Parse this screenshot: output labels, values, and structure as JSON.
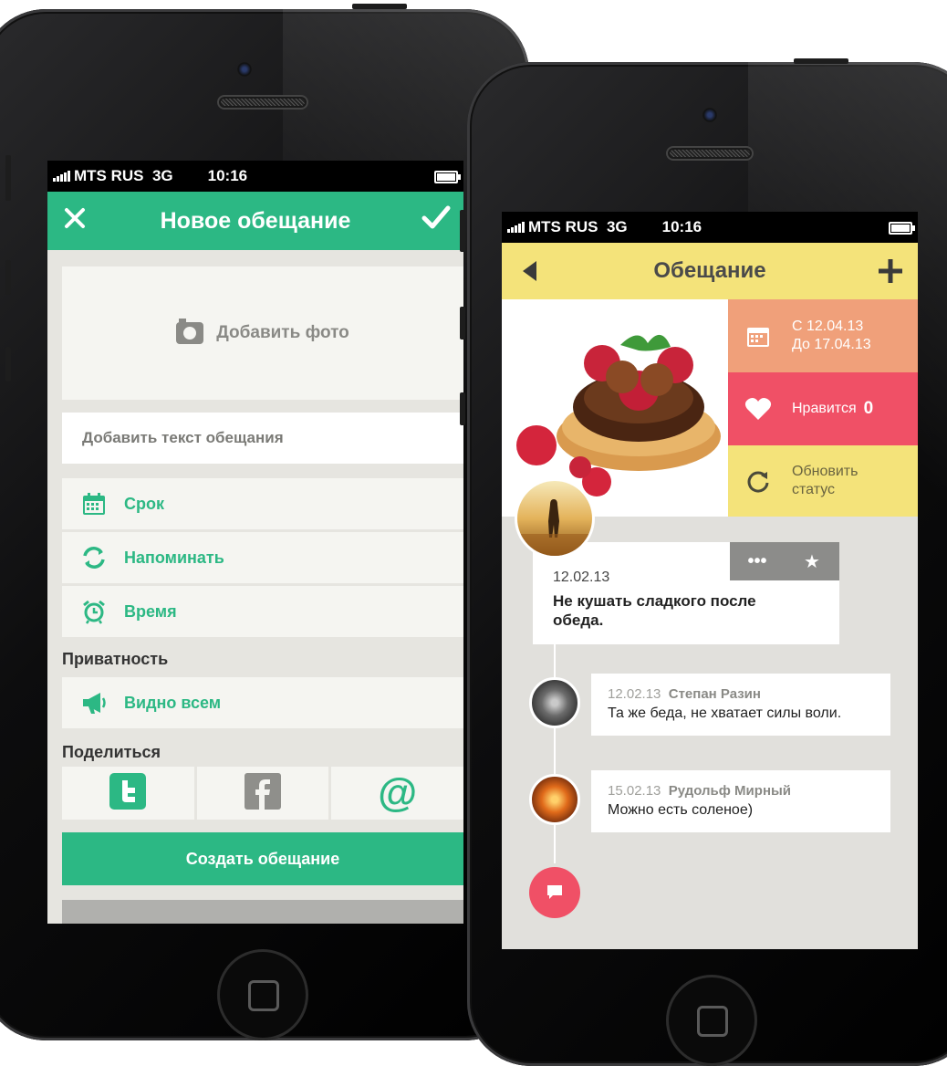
{
  "colors": {
    "green_accent": "#2cb884",
    "yellow_header": "#f4e37a",
    "salmon_tile": "#f0a07a",
    "red_tile": "#f05066",
    "yellow_tile": "#f4e37a"
  },
  "left_phone": {
    "status": {
      "carrier": "MTS RUS",
      "network": "3G",
      "time": "10:16"
    },
    "header": {
      "title": "Новое обещание",
      "close_icon": "close-icon",
      "confirm_icon": "checkmark-icon"
    },
    "photo": {
      "label": "Добавить фото",
      "icon": "camera-icon"
    },
    "text_field": {
      "placeholder": "Добавить текст обещания"
    },
    "options": [
      {
        "label": "Срок",
        "icon": "calendar-icon"
      },
      {
        "label": "Напоминать",
        "icon": "repeat-icon"
      },
      {
        "label": "Время",
        "icon": "alarm-clock-icon"
      }
    ],
    "privacy": {
      "section_title": "Приватность",
      "label": "Видно всем",
      "icon": "megaphone-icon"
    },
    "share": {
      "section_title": "Поделиться",
      "targets": [
        {
          "name": "twitter",
          "icon": "twitter-icon"
        },
        {
          "name": "facebook",
          "icon": "facebook-icon"
        },
        {
          "name": "email",
          "icon": "at-sign-icon"
        }
      ]
    },
    "create_button": "Создать обещание"
  },
  "right_phone": {
    "status": {
      "carrier": "MTS RUS",
      "network": "3G",
      "time": "10:16"
    },
    "header": {
      "title": "Обещание",
      "back_icon": "back-arrow-icon",
      "add_icon": "plus-icon"
    },
    "dates": {
      "from": "С 12.04.13",
      "to": "До 17.04.13"
    },
    "likes": {
      "label": "Нравится",
      "count": "0"
    },
    "update_status": {
      "line1": "Обновить",
      "line2": "статус"
    },
    "post": {
      "date": "12.02.13",
      "text": "Не кушать сладкого после обеда.",
      "more_icon": "more-dots-icon",
      "star_icon": "star-icon"
    },
    "comments": [
      {
        "date": "12.02.13",
        "author": "Степан Разин",
        "text": "Та же беда, не хватает силы воли."
      },
      {
        "date": "15.02.13",
        "author": "Рудольф Мирный",
        "text": "Можно есть соленое)"
      }
    ],
    "chat_icon": "chat-bubble-icon"
  }
}
